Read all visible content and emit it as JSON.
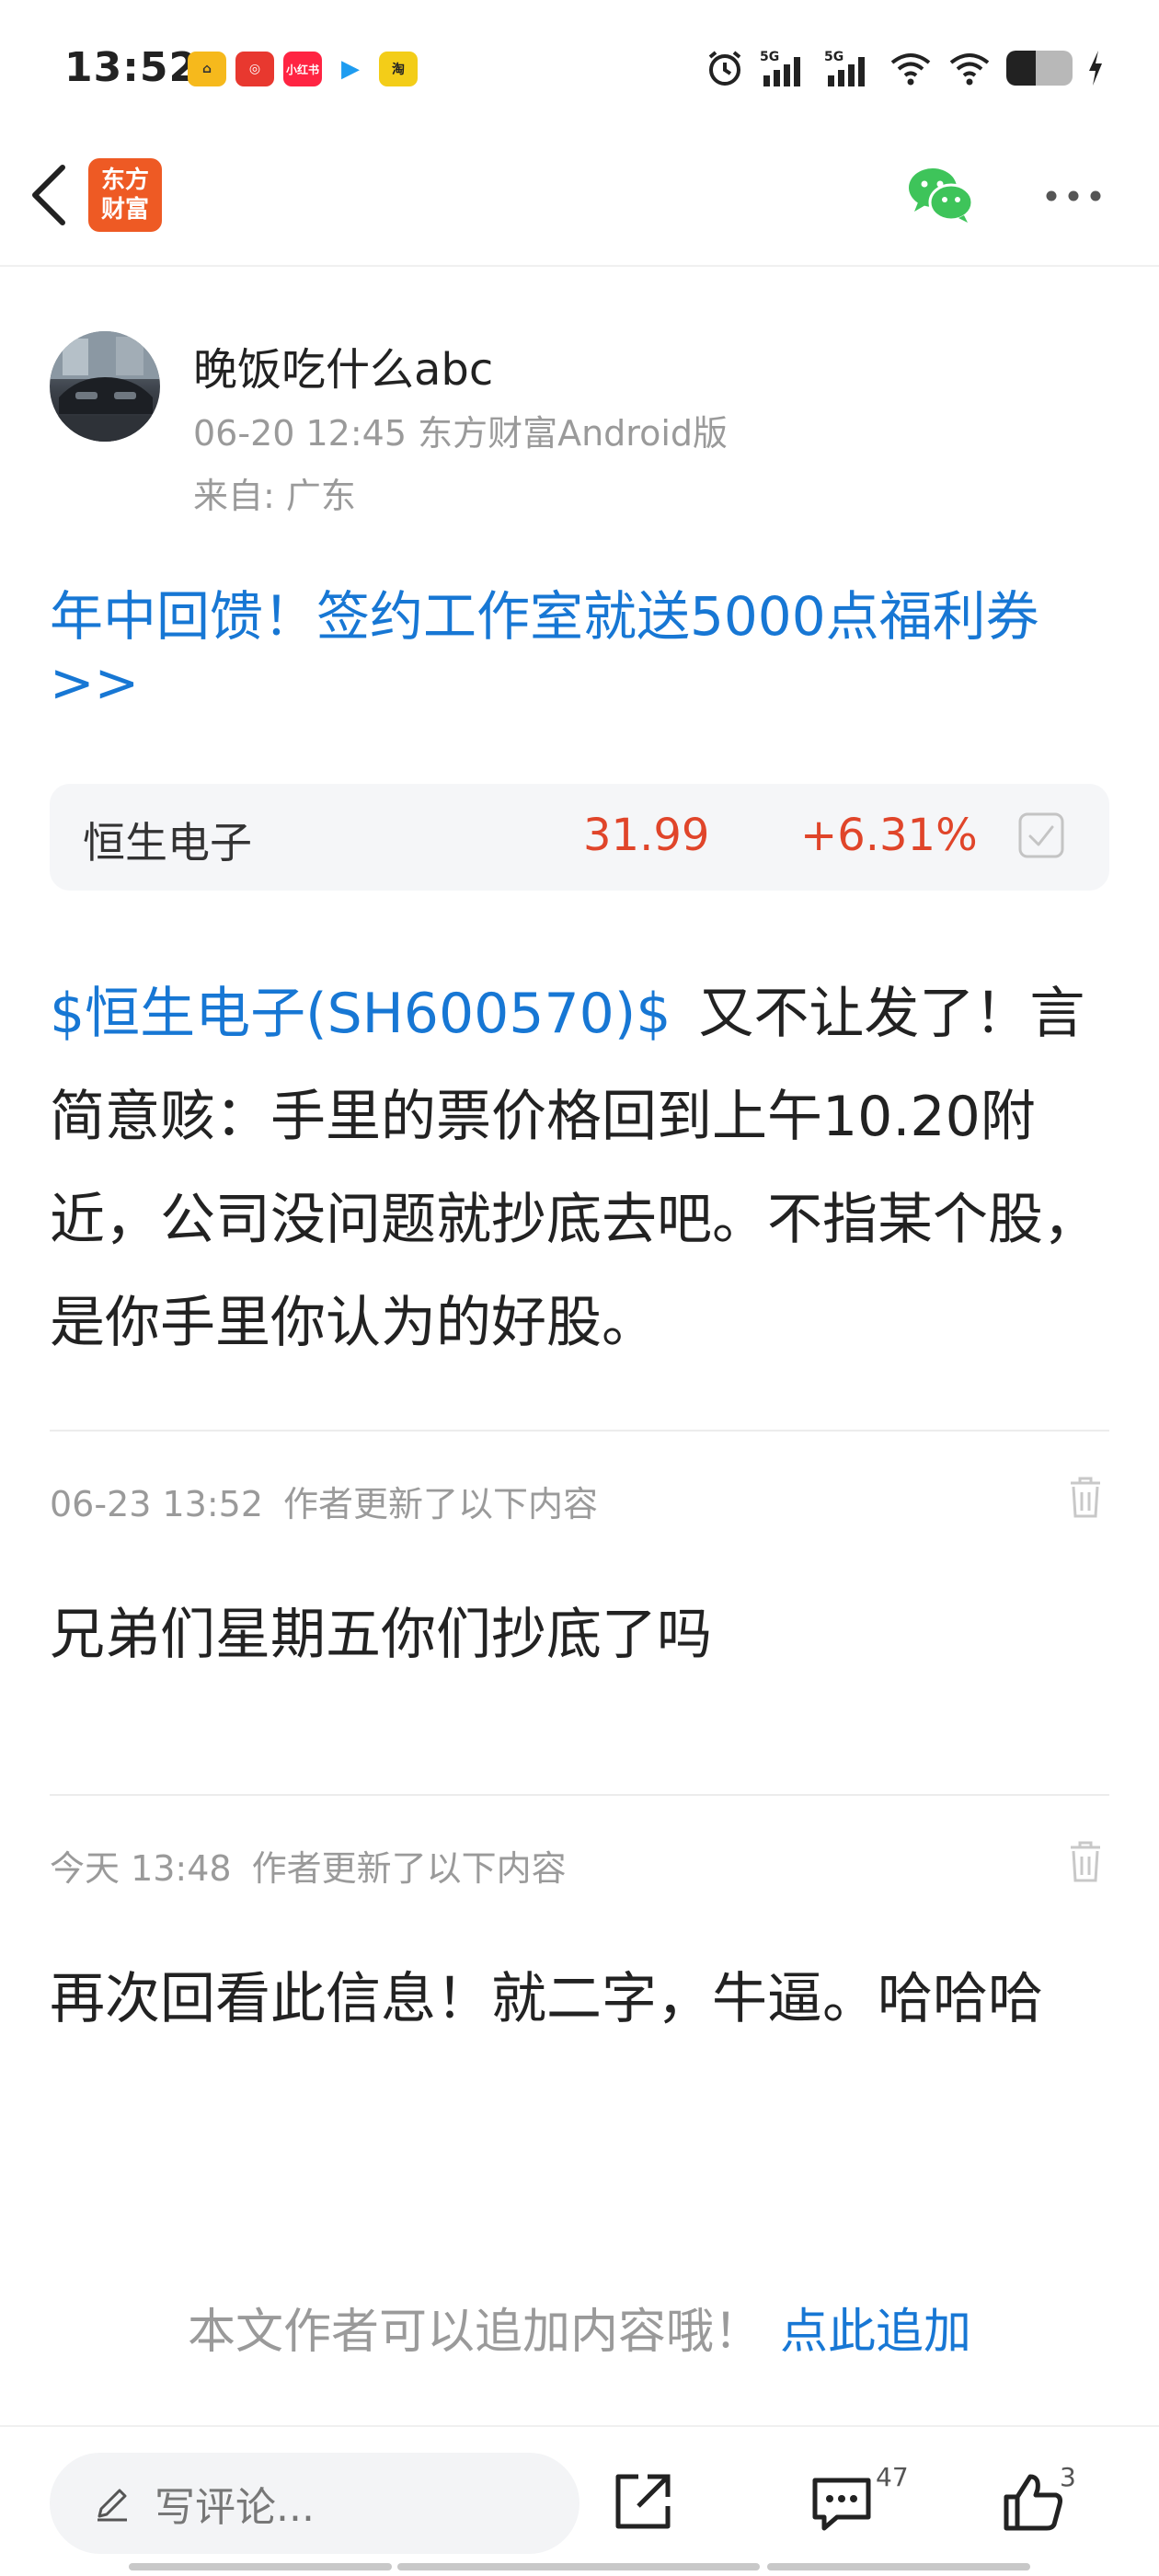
{
  "status_bar": {
    "time": "13:52",
    "app_icons": [
      {
        "name": "app-icon-1",
        "color": "#f6b91c",
        "glyph": "⌂"
      },
      {
        "name": "app-icon-2",
        "color": "#e8382f",
        "glyph": "◎"
      },
      {
        "name": "xiaohongshu-icon",
        "color": "#ff2442",
        "glyph": "小红书"
      },
      {
        "name": "app-icon-4",
        "color": "#ffffff",
        "glyph": "▶"
      },
      {
        "name": "app-icon-5",
        "color": "#f3cd18",
        "glyph": "淘"
      }
    ],
    "signal_1": "5G",
    "signal_2": "5G",
    "battery_percent": 45
  },
  "header": {
    "logo_line1": "东方",
    "logo_line2": "财富"
  },
  "post": {
    "author": "晚饭吃什么abc",
    "meta": "06-20 12:45 东方财富Android版",
    "from": "来自: 广东",
    "promo": "年中回馈！签约工作室就送5000点福利券>>",
    "stock": {
      "name": "恒生电子",
      "price": "31.99",
      "change": "+6.31%"
    },
    "stock_link": "$恒生电子(SH600570)$",
    "body": "又不让发了！言简意赅：手里的票价格回到上午10.20附近，公司没问题就抄底去吧。不指某个股，是你手里你认为的好股。"
  },
  "updates": [
    {
      "time": "06-23 13:52",
      "author_label": "作者更新了以下内容",
      "text": "兄弟们星期五你们抄底了吗"
    },
    {
      "time": "今天 13:48",
      "author_label": "作者更新了以下内容",
      "text": "再次回看此信息！就二字，牛逼。哈哈哈"
    }
  ],
  "append": {
    "prompt": "本文作者可以追加内容哦！",
    "link": "点此追加"
  },
  "bottom_bar": {
    "comment_placeholder": "写评论...",
    "comment_count": "47",
    "like_count": "3"
  },
  "colors": {
    "accent_blue": "#1777d4",
    "stock_red": "#e0452a",
    "brand_orange": "#ee5a24",
    "wechat_green": "#3ec45a"
  }
}
